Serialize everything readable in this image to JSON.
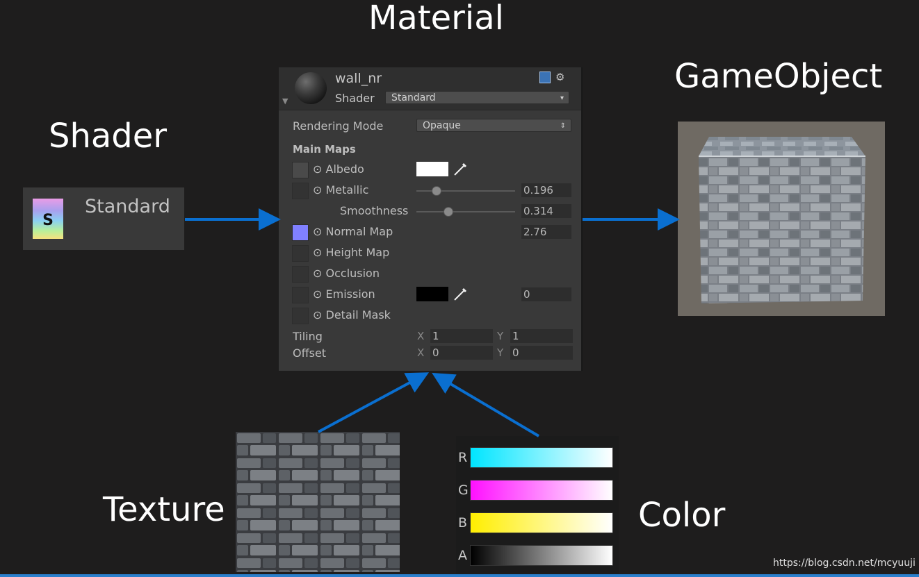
{
  "titles": {
    "material": "Material",
    "gameobject": "GameObject",
    "shader": "Shader",
    "texture": "Texture",
    "color": "Color"
  },
  "shader_card": {
    "icon_letter": "S",
    "name": "Standard"
  },
  "inspector": {
    "material_name": "wall_nr",
    "shader_label": "Shader",
    "shader_value": "Standard",
    "rendering_mode_label": "Rendering Mode",
    "rendering_mode_value": "Opaque",
    "section_title": "Main Maps",
    "rows": {
      "albedo": "Albedo",
      "metallic": "Metallic",
      "metallic_value": "0.196",
      "metallic_level": 0.196,
      "smoothness": "Smoothness",
      "smoothness_value": "0.314",
      "smoothness_level": 0.314,
      "normal_map": "Normal Map",
      "normal_value": "2.76",
      "height_map": "Height Map",
      "occlusion": "Occlusion",
      "emission": "Emission",
      "emission_value": "0",
      "detail_mask": "Detail Mask"
    },
    "tiling": {
      "label": "Tiling",
      "x_letter": "X",
      "x": "1",
      "y_letter": "Y",
      "y": "1"
    },
    "offset": {
      "label": "Offset",
      "x_letter": "X",
      "x": "0",
      "y_letter": "Y",
      "y": "0"
    },
    "colors": {
      "albedo_swatch": "#ffffff",
      "emission_swatch": "#000000",
      "normal_map_thumb": "#8080ff"
    }
  },
  "color_channels": [
    {
      "letter": "R",
      "from": "#00e5ff",
      "to": "#ffffff"
    },
    {
      "letter": "G",
      "from": "#ff10ff",
      "to": "#ffffff"
    },
    {
      "letter": "B",
      "from": "#ffee00",
      "to": "#ffffff"
    },
    {
      "letter": "A",
      "from": "#000000",
      "to": "#ffffff"
    }
  ],
  "arrow_color": "#0a6fd0",
  "watermark": "https://blog.csdn.net/mcyuuji"
}
